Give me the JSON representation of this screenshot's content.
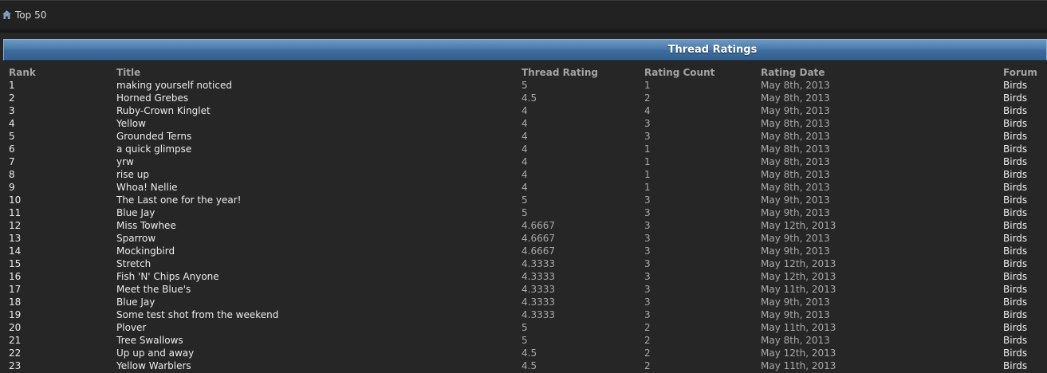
{
  "breadcrumb": {
    "label": "Top 50"
  },
  "table": {
    "title": "Thread Ratings",
    "columns": {
      "rank": "Rank",
      "title": "Title",
      "rating": "Thread Rating",
      "count": "Rating Count",
      "date": "Rating Date",
      "forum": "Forum"
    },
    "rows": [
      {
        "rank": "1",
        "title": "making yourself noticed",
        "rating": "5",
        "count": "1",
        "date": "May 8th, 2013",
        "forum": "Birds"
      },
      {
        "rank": "2",
        "title": "Horned Grebes",
        "rating": "4.5",
        "count": "2",
        "date": "May 8th, 2013",
        "forum": "Birds"
      },
      {
        "rank": "3",
        "title": "Ruby-Crown Kinglet",
        "rating": "4",
        "count": "4",
        "date": "May 9th, 2013",
        "forum": "Birds"
      },
      {
        "rank": "4",
        "title": "Yellow",
        "rating": "4",
        "count": "3",
        "date": "May 8th, 2013",
        "forum": "Birds"
      },
      {
        "rank": "5",
        "title": "Grounded Terns",
        "rating": "4",
        "count": "3",
        "date": "May 8th, 2013",
        "forum": "Birds"
      },
      {
        "rank": "6",
        "title": "a quick glimpse",
        "rating": "4",
        "count": "1",
        "date": "May 8th, 2013",
        "forum": "Birds"
      },
      {
        "rank": "7",
        "title": "yrw",
        "rating": "4",
        "count": "1",
        "date": "May 8th, 2013",
        "forum": "Birds"
      },
      {
        "rank": "8",
        "title": "rise up",
        "rating": "4",
        "count": "1",
        "date": "May 8th, 2013",
        "forum": "Birds"
      },
      {
        "rank": "9",
        "title": "Whoa! Nellie",
        "rating": "4",
        "count": "1",
        "date": "May 8th, 2013",
        "forum": "Birds"
      },
      {
        "rank": "10",
        "title": "The Last one for the year!",
        "rating": "5",
        "count": "3",
        "date": "May 9th, 2013",
        "forum": "Birds"
      },
      {
        "rank": "11",
        "title": "Blue Jay",
        "rating": "5",
        "count": "3",
        "date": "May 9th, 2013",
        "forum": "Birds"
      },
      {
        "rank": "12",
        "title": "Miss Towhee",
        "rating": "4.6667",
        "count": "3",
        "date": "May 12th, 2013",
        "forum": "Birds"
      },
      {
        "rank": "13",
        "title": "Sparrow",
        "rating": "4.6667",
        "count": "3",
        "date": "May 9th, 2013",
        "forum": "Birds"
      },
      {
        "rank": "14",
        "title": "Mockingbird",
        "rating": "4.6667",
        "count": "3",
        "date": "May 9th, 2013",
        "forum": "Birds"
      },
      {
        "rank": "15",
        "title": "Stretch",
        "rating": "4.3333",
        "count": "3",
        "date": "May 12th, 2013",
        "forum": "Birds"
      },
      {
        "rank": "16",
        "title": "Fish 'N' Chips Anyone",
        "rating": "4.3333",
        "count": "3",
        "date": "May 12th, 2013",
        "forum": "Birds"
      },
      {
        "rank": "17",
        "title": "Meet the Blue's",
        "rating": "4.3333",
        "count": "3",
        "date": "May 11th, 2013",
        "forum": "Birds"
      },
      {
        "rank": "18",
        "title": "Blue Jay",
        "rating": "4.3333",
        "count": "3",
        "date": "May 9th, 2013",
        "forum": "Birds"
      },
      {
        "rank": "19",
        "title": "Some test shot from the weekend",
        "rating": "4.3333",
        "count": "3",
        "date": "May 9th, 2013",
        "forum": "Birds"
      },
      {
        "rank": "20",
        "title": "Plover",
        "rating": "5",
        "count": "2",
        "date": "May 11th, 2013",
        "forum": "Birds"
      },
      {
        "rank": "21",
        "title": "Tree Swallows",
        "rating": "5",
        "count": "2",
        "date": "May 8th, 2013",
        "forum": "Birds"
      },
      {
        "rank": "22",
        "title": "Up up and away",
        "rating": "4.5",
        "count": "2",
        "date": "May 12th, 2013",
        "forum": "Birds"
      },
      {
        "rank": "23",
        "title": "Yellow Warblers",
        "rating": "4.5",
        "count": "2",
        "date": "May 11th, 2013",
        "forum": "Birds"
      }
    ]
  },
  "colors": {
    "background": "#262626",
    "header_bar": "#4a7aab",
    "icon": "#6f8fb0"
  },
  "icons": {
    "home": "home-icon"
  }
}
